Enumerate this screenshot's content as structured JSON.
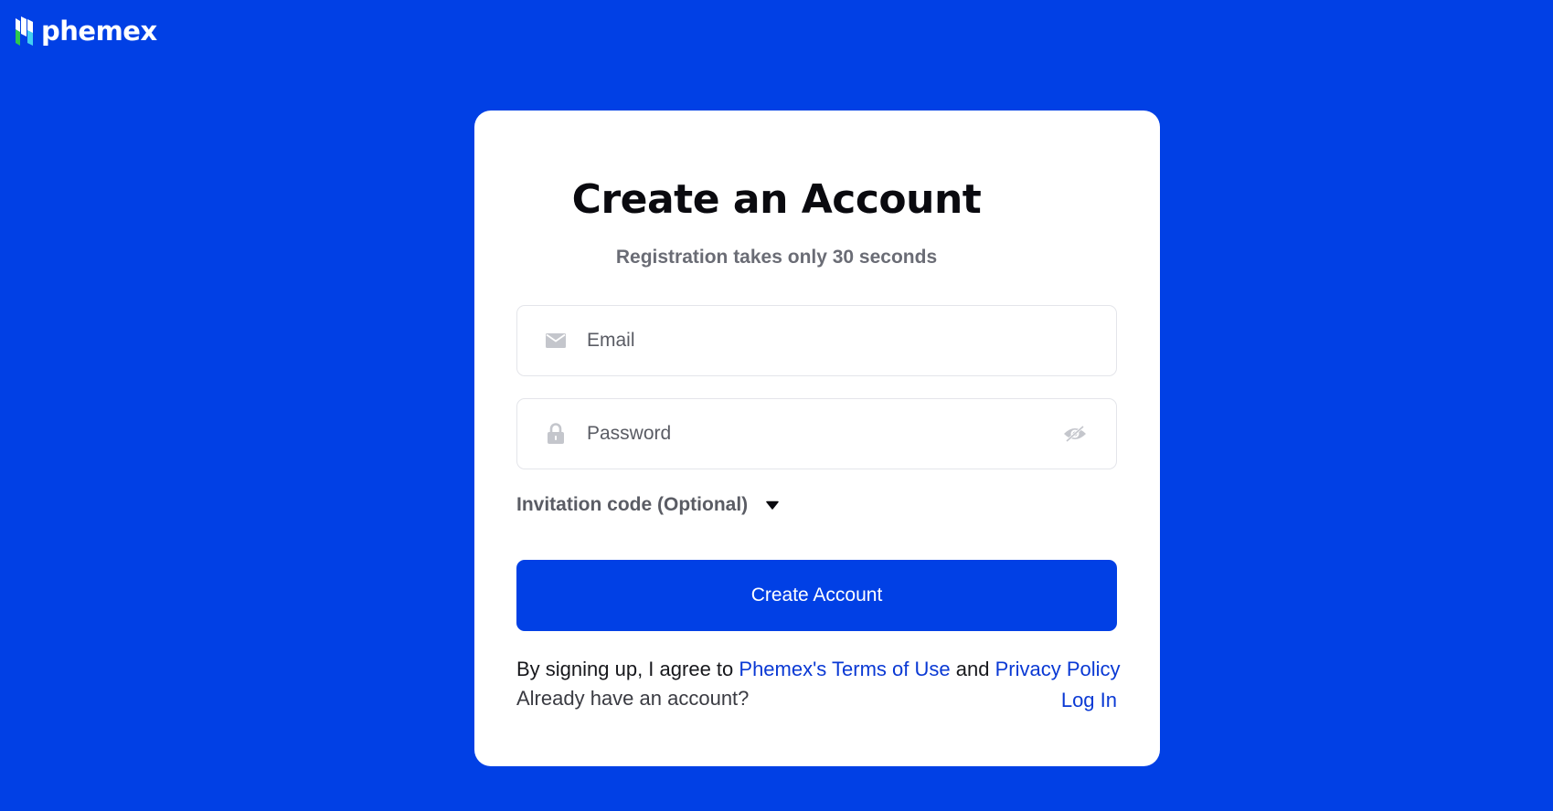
{
  "brand": {
    "name": "phemex",
    "colors": {
      "background": "#0140e5",
      "mark_green": "#2ec84d",
      "mark_cyan": "#43d0f2",
      "mark_white": "#ffffff",
      "link": "#0a39d4"
    }
  },
  "form": {
    "title": "Create an Account",
    "subtitle": "Registration takes only 30 seconds",
    "email": {
      "placeholder": "Email",
      "value": "",
      "icon": "mail-icon"
    },
    "password": {
      "placeholder": "Password",
      "value": "",
      "icon": "lock-icon",
      "toggle_icon": "eye-off-icon"
    },
    "invitation": {
      "label": "Invitation code (Optional)",
      "icon": "caret-down-icon"
    },
    "submit_label": "Create Account"
  },
  "footer": {
    "terms_prefix": "By signing up, I agree to",
    "terms_link": "Phemex's Terms of Use",
    "terms_and": "and",
    "privacy_link": "Privacy Policy",
    "already_text": "Already have an account?",
    "login_link": "Log In"
  }
}
